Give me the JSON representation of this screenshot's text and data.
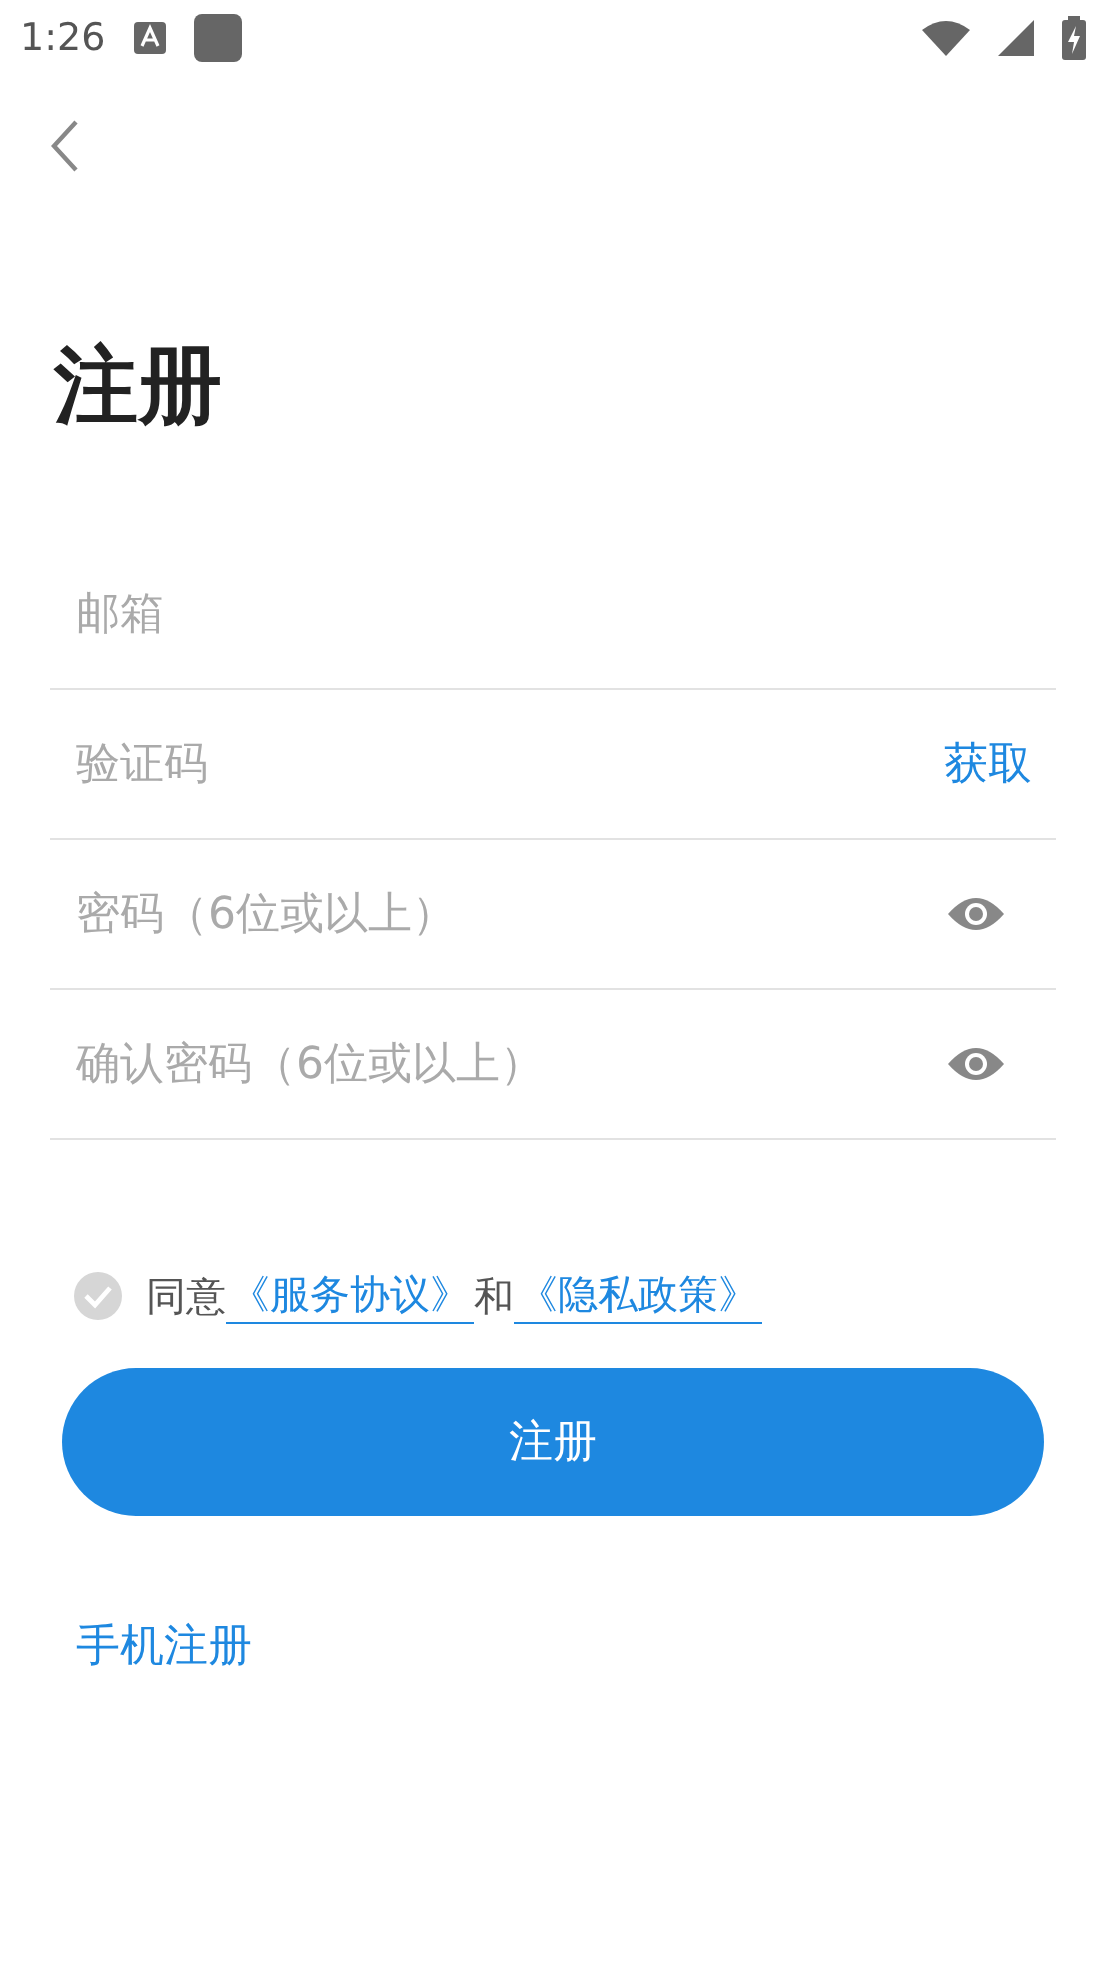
{
  "status_bar": {
    "time": "1:26"
  },
  "title": "注册",
  "fields": [
    {
      "kind": "plain",
      "placeholder": "邮箱"
    },
    {
      "kind": "code",
      "placeholder": "验证码",
      "action": "获取"
    },
    {
      "kind": "password",
      "placeholder": "密码（6位或以上）"
    },
    {
      "kind": "password",
      "placeholder": "确认密码（6位或以上）"
    }
  ],
  "agreement": {
    "checked": false,
    "prefix": "同意",
    "link_1": "《服务协议》",
    "joiner": "和",
    "link_2": "《隐私政策》"
  },
  "submit_button": "注册",
  "alt_link": "手机注册"
}
